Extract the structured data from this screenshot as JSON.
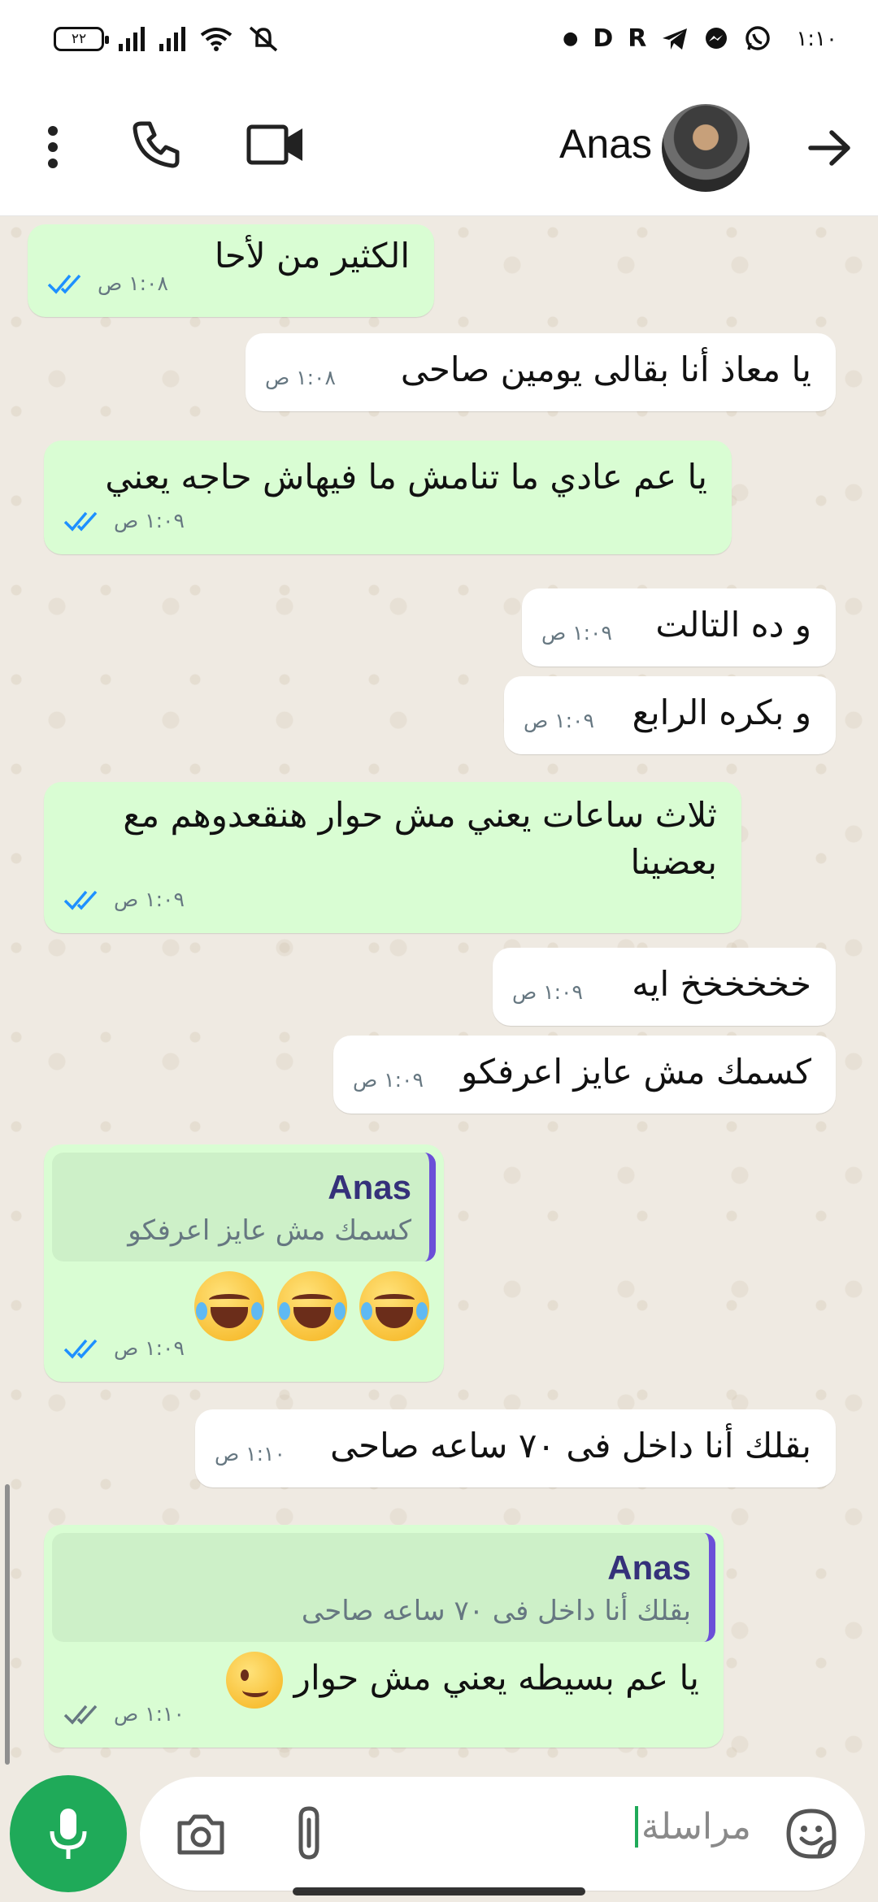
{
  "status_bar": {
    "battery": "٢٢",
    "time": "١:١٠",
    "app_icons": [
      "dot-icon",
      "d-app-icon",
      "r-app-icon",
      "telegram-icon",
      "messenger-icon",
      "whatsapp-icon"
    ]
  },
  "header": {
    "contact_name": "Anas",
    "icons": [
      "back-arrow-icon",
      "avatar",
      "video-call-icon",
      "voice-call-icon",
      "more-options-icon"
    ]
  },
  "messages": [
    {
      "dir": "out",
      "text": "الكثير من لأحا",
      "time": "١:٠٨ ص",
      "status": "read"
    },
    {
      "dir": "in",
      "text": "يا معاذ أنا بقالى يومين صاحى",
      "time": "١:٠٨ ص"
    },
    {
      "dir": "out",
      "text": "يا عم عادي ما تنامش ما فيهاش حاجه يعني",
      "time": "١:٠٩ ص",
      "status": "read"
    },
    {
      "dir": "in",
      "text": "و ده التالت",
      "time": "١:٠٩ ص"
    },
    {
      "dir": "in",
      "text": "و بكره الرابع",
      "time": "١:٠٩ ص"
    },
    {
      "dir": "out",
      "text": "ثلاث ساعات يعني مش حوار هنقعدوهم مع بعضينا",
      "time": "١:٠٩ ص",
      "status": "read"
    },
    {
      "dir": "in",
      "text": "خخخخخخ ايه",
      "time": "١:٠٩ ص"
    },
    {
      "dir": "in",
      "text": "كسمك مش عايز اعرفكو",
      "time": "١:٠٩ ص"
    },
    {
      "dir": "out",
      "quote_name": "Anas",
      "quote_text": "كسمك مش عايز اعرفكو",
      "emoji": [
        "face-with-tears-of-joy",
        "face-with-tears-of-joy",
        "face-with-tears-of-joy"
      ],
      "time": "١:٠٩ ص",
      "status": "read"
    },
    {
      "dir": "in",
      "text": "بقلك أنا داخل فى ٧٠ ساعه صاحى",
      "time": "١:١٠ ص"
    },
    {
      "dir": "out",
      "quote_name": "Anas",
      "quote_text": "بقلك أنا داخل فى ٧٠ ساعه صاحى",
      "text": "يا عم بسيطه يعني مش حوار",
      "emoji": [
        "smirking-face"
      ],
      "time": "١:١٠ ص",
      "status": "delivered"
    }
  ],
  "composer": {
    "placeholder": "مراسلة",
    "icons": [
      "mic-icon",
      "camera-icon",
      "attach-icon",
      "sticker-icon"
    ]
  },
  "colors": {
    "outgoing_bubble": "#d9fdd3",
    "incoming_bubble": "#ffffff",
    "chat_background": "#efeae2",
    "read_ticks": "#1e90ff",
    "accent": "#1faa59",
    "quote_bar": "#6b4fd8"
  }
}
